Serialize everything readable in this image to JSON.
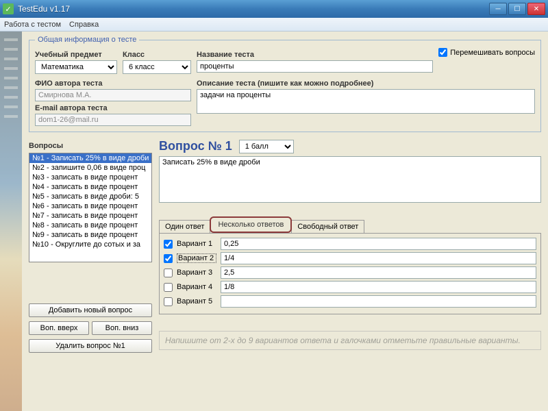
{
  "titlebar": {
    "text": "TestEdu v1.17"
  },
  "menu": {
    "work": "Работа с тестом",
    "help": "Справка"
  },
  "group_info": {
    "legend": "Общая информация о тесте",
    "subject_label": "Учебный предмет",
    "subject_value": "Математика",
    "class_label": "Класс",
    "class_value": "6 класс",
    "testname_label": "Название теста",
    "testname_value": "проценты",
    "shuffle_label": "Перемешивать вопросы",
    "author_label": "ФИО автора теста",
    "author_value": "Смирнова М.А.",
    "email_label": "E-mail автора теста",
    "email_value": "dom1-26@mail.ru",
    "desc_label": "Описание теста (пишите как можно подробнее)",
    "desc_value": "задачи на проценты"
  },
  "qlist": {
    "label": "Вопросы",
    "items": [
      "№1 - Записать 25% в виде дроби",
      "№2 - запишите 0,06 в виде проц",
      "№3 - записать в виде процент",
      "№4 - записать в виде процент",
      "№5 - записать в виде дроби: 5",
      "№6 - записать в виде процент",
      "№7 - записать в виде процент",
      "№8 - записать в виде процент",
      "№9 - записать в виде процент",
      "№10 - Округлите до сотых и за"
    ]
  },
  "buttons": {
    "add": "Добавить новый вопрос",
    "up": "Воп. вверх",
    "down": "Воп. вниз",
    "del": "Удалить вопрос №1"
  },
  "question": {
    "title": "Вопрос № 1",
    "points_value": "1 балл",
    "text": "Записать 25% в виде дроби"
  },
  "tabs": {
    "one": "Один ответ",
    "many": "Несколько ответов",
    "free": "Свободный ответ"
  },
  "answers": [
    {
      "label": "Вариант 1",
      "value": "0,25",
      "checked": true
    },
    {
      "label": "Вариант 2",
      "value": "1/4",
      "checked": true
    },
    {
      "label": "Вариант 3",
      "value": "2,5",
      "checked": false
    },
    {
      "label": "Вариант 4",
      "value": "1/8",
      "checked": false
    },
    {
      "label": "Вариант 5",
      "value": "",
      "checked": false
    }
  ],
  "hint": "Напишите от 2-х до 9 вариантов ответа и галочками отметьте правильные варианты."
}
